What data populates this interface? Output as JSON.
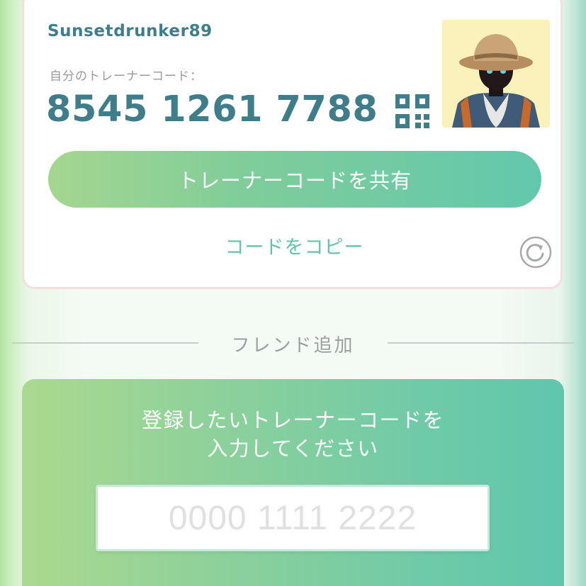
{
  "profile": {
    "username": "Sunsetdrunker89",
    "code_label": "自分のトレーナーコード：",
    "trainer_code": "8545 1261 7788"
  },
  "actions": {
    "share_label": "トレーナーコードを共有",
    "copy_label": "コードをコピー"
  },
  "add_friend": {
    "section_title": "フレンド追加",
    "instruction_line1": "登録したいトレーナーコードを",
    "instruction_line2": "入力してください",
    "input_placeholder": "0000 1111 2222",
    "input_value": ""
  },
  "icons": {
    "qr": "qr-code-icon",
    "refresh": "refresh-icon"
  },
  "colors": {
    "accent_text": "#3f7d8b",
    "copy_text": "#64c4a2",
    "gradient_start": "#a5d68f",
    "gradient_end": "#62c8ad"
  }
}
